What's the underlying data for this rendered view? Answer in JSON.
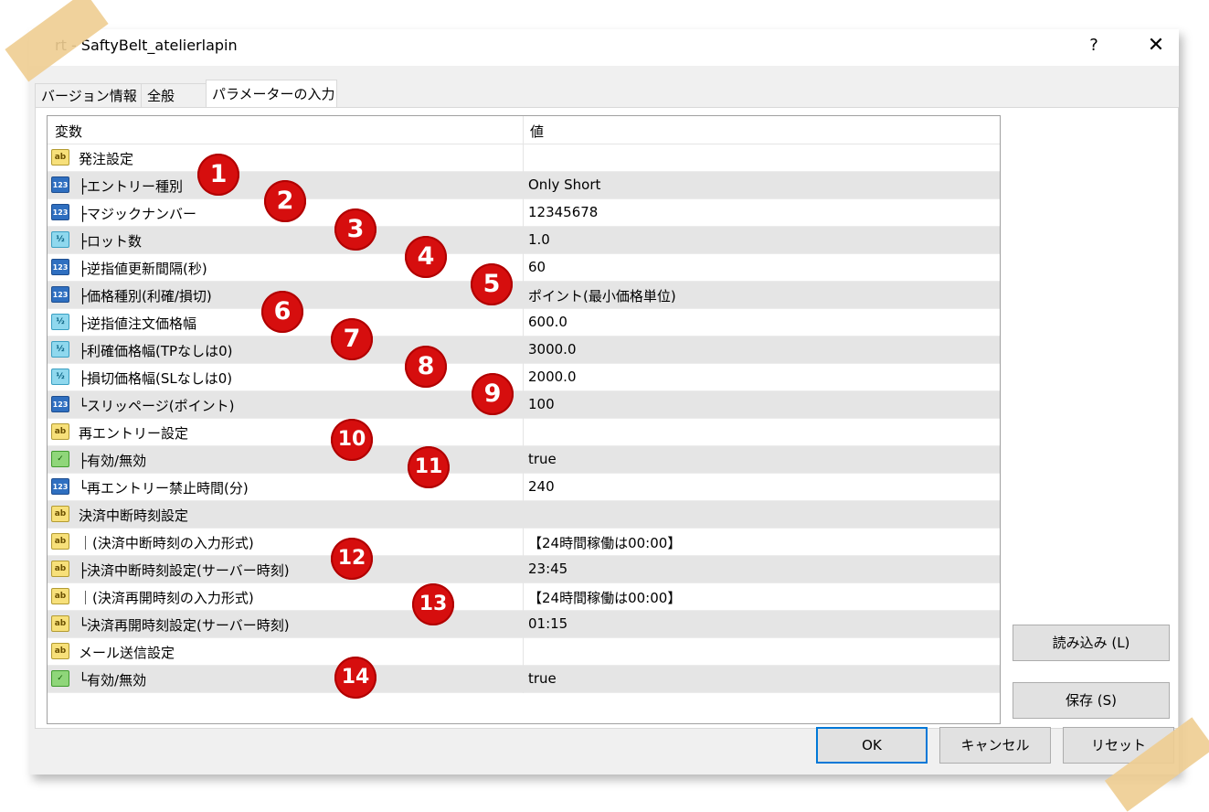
{
  "window": {
    "title": "rt - SaftyBelt_atelierlapin",
    "help_label": "?",
    "close_label": "✕"
  },
  "tabs": [
    {
      "label": "バージョン情報"
    },
    {
      "label": "全般"
    },
    {
      "label": "パラメーターの入力"
    }
  ],
  "grid": {
    "header_variable": "変数",
    "header_value": "値",
    "rows": [
      {
        "icon": "ab",
        "name": "発注設定",
        "value": ""
      },
      {
        "icon": "int",
        "name": "├エントリー種別",
        "value": "Only Short"
      },
      {
        "icon": "int",
        "name": "├マジックナンバー",
        "value": "12345678"
      },
      {
        "icon": "dbl",
        "name": "├ロット数",
        "value": "1.0"
      },
      {
        "icon": "int",
        "name": "├逆指値更新間隔(秒)",
        "value": "60"
      },
      {
        "icon": "int",
        "name": "├価格種別(利確/損切)",
        "value": "ポイント(最小価格単位)"
      },
      {
        "icon": "dbl",
        "name": "├逆指値注文価格幅",
        "value": "600.0"
      },
      {
        "icon": "dbl",
        "name": "├利確価格幅(TPなしは0)",
        "value": "3000.0"
      },
      {
        "icon": "dbl",
        "name": "├損切価格幅(SLなしは0)",
        "value": "2000.0"
      },
      {
        "icon": "int",
        "name": "└スリッページ(ポイント)",
        "value": "100"
      },
      {
        "icon": "ab",
        "name": "再エントリー設定",
        "value": ""
      },
      {
        "icon": "bool",
        "name": "├有効/無効",
        "value": "true"
      },
      {
        "icon": "int",
        "name": "└再エントリー禁止時間(分)",
        "value": "240"
      },
      {
        "icon": "ab",
        "name": "決済中断時刻設定",
        "value": ""
      },
      {
        "icon": "ab",
        "name": "｜(決済中断時刻の入力形式)",
        "value": "【24時間稼働は00:00】"
      },
      {
        "icon": "ab",
        "name": "├決済中断時刻設定(サーバー時刻)",
        "value": "23:45"
      },
      {
        "icon": "ab",
        "name": "｜(決済再開時刻の入力形式)",
        "value": "【24時間稼働は00:00】"
      },
      {
        "icon": "ab",
        "name": "└決済再開時刻設定(サーバー時刻)",
        "value": "01:15"
      },
      {
        "icon": "ab",
        "name": "メール送信設定",
        "value": ""
      },
      {
        "icon": "bool",
        "name": "└有効/無効",
        "value": "true"
      }
    ]
  },
  "icon_labels": {
    "ab": "ab",
    "int": "123",
    "dbl": "½",
    "bool": "✓"
  },
  "badges": [
    "1",
    "2",
    "3",
    "4",
    "5",
    "6",
    "7",
    "8",
    "9",
    "10",
    "11",
    "12",
    "13",
    "14"
  ],
  "buttons": {
    "load": "読み込み (L)",
    "save": "保存 (S)",
    "ok": "OK",
    "cancel": "キャンセル",
    "reset": "リセット"
  },
  "colors": {
    "badge": "#d60e0e",
    "dialog_bg": "#f0f0f0",
    "alt_row": "#e5e5e5",
    "default_button_border": "#0078d7"
  }
}
